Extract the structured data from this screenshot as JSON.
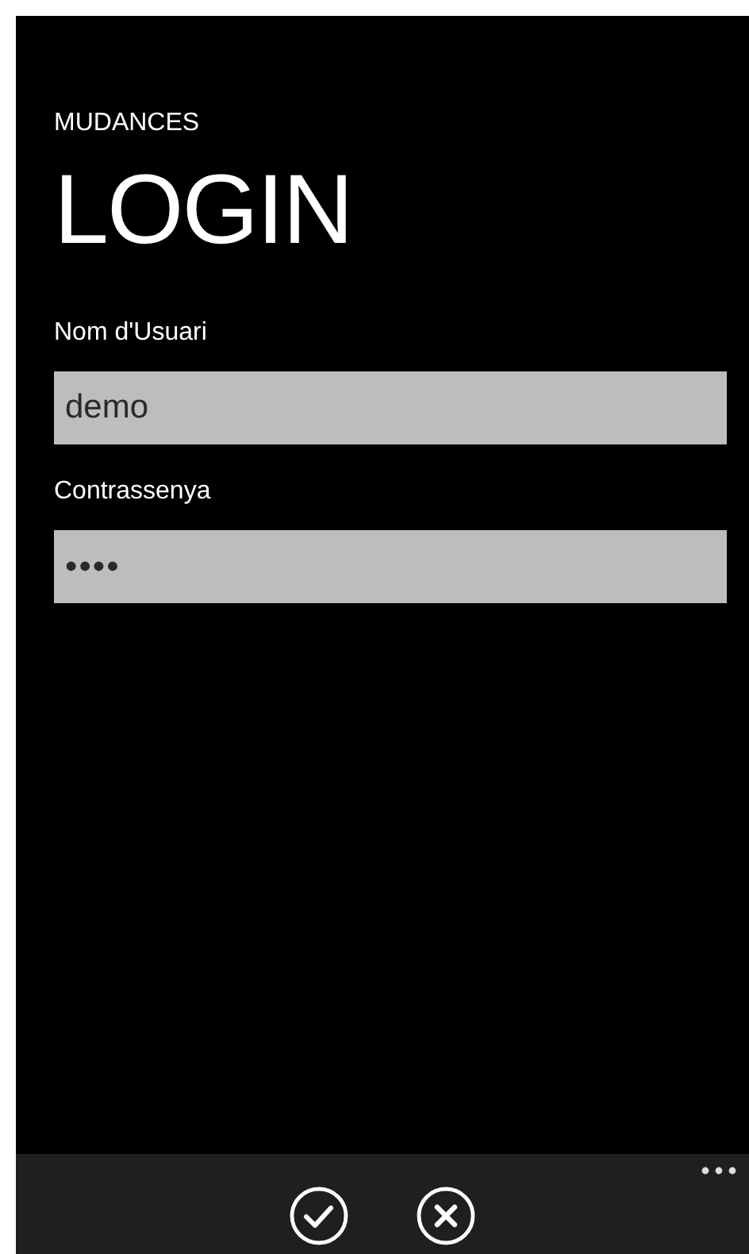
{
  "app_title": "MUDANCES",
  "page_title": "LOGIN",
  "fields": [
    {
      "label": "Nom d'Usuari",
      "value": "demo",
      "kind": "text"
    },
    {
      "label": "Contrassenya",
      "value": "••••",
      "kind": "password"
    }
  ],
  "app_bar": {
    "buttons": [
      {
        "kind": "accept"
      },
      {
        "kind": "cancel"
      }
    ],
    "more": true
  }
}
